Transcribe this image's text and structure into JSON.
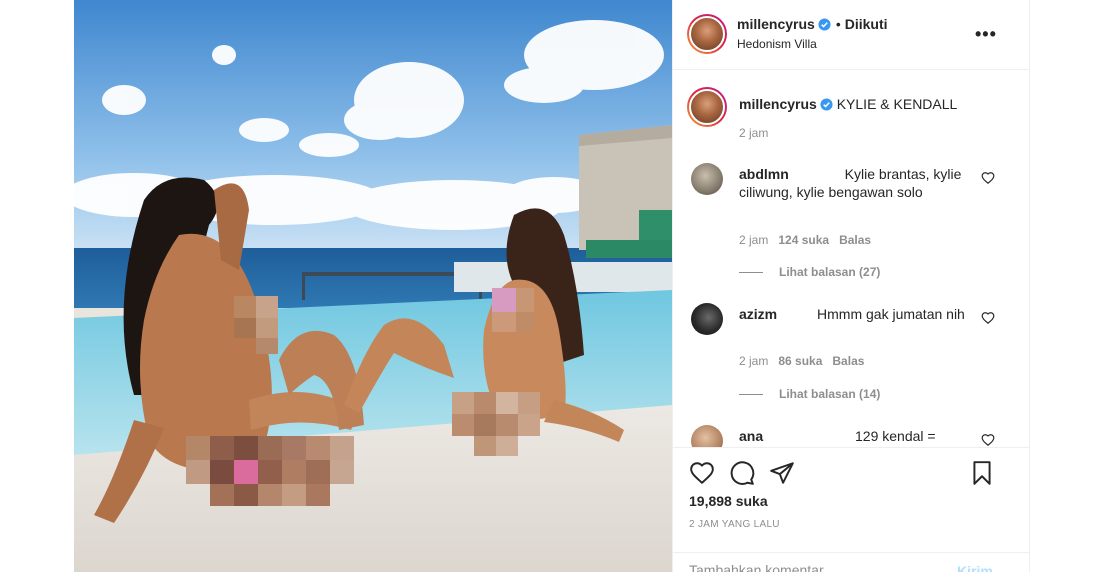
{
  "post": {
    "photo_alt": "",
    "header": {
      "username": "millencyrus",
      "follow_status": "Diikuti",
      "location": "Hedonism Villa",
      "more_icon": "more-horizontal-icon"
    },
    "caption": {
      "username": "millencyrus",
      "text": "KYLIE & KENDALL",
      "time": "2 jam"
    },
    "comments": [
      {
        "username": "abdlmn",
        "text": "Kylie brantas, kylie ciliwung, kylie bengawan solo",
        "time": "2 jam",
        "likes": "124 suka",
        "reply": "Balas",
        "view_replies": "Lihat balasan (27)"
      },
      {
        "username": "azizm",
        "text": "Hmmm gak jumatan nih",
        "time": "2 jam",
        "likes": "86 suka",
        "reply": "Balas",
        "view_replies": "Lihat balasan (14)"
      },
      {
        "username": "ana",
        "text": "129 kendal =",
        "time": "",
        "likes": "",
        "reply": "",
        "view_replies": ""
      }
    ],
    "likes": "19,898 suka",
    "time_ago": "2 JAM YANG LALU",
    "add_comment": {
      "placeholder": "Tambahkan komentar...",
      "post_label": "Kirim"
    }
  },
  "colors": {
    "verified": "#3897f0",
    "link_disabled": "#b2dffc",
    "muted": "#8e8e8e"
  },
  "icons": [
    "heart-icon",
    "comment-icon",
    "share-icon",
    "bookmark-icon",
    "verified-badge-icon",
    "chevron-right-icon"
  ]
}
